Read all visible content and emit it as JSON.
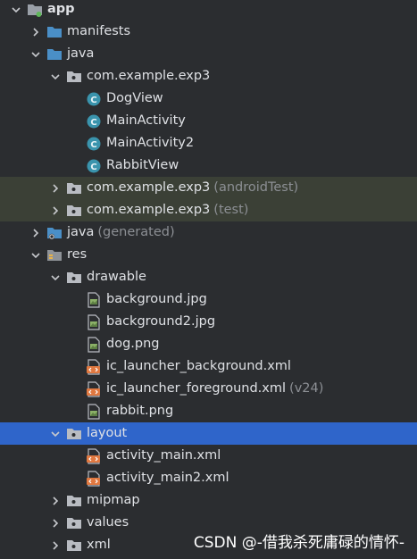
{
  "tree": {
    "rows": [
      {
        "label": "app",
        "suffix": "",
        "icon": "module-folder-icon",
        "depth": 0,
        "chevron": "down"
      },
      {
        "label": "manifests",
        "suffix": "",
        "icon": "folder-icon",
        "depth": 1,
        "chevron": "right"
      },
      {
        "label": "java",
        "suffix": "",
        "icon": "folder-icon",
        "depth": 1,
        "chevron": "down"
      },
      {
        "label": "com.example.exp3",
        "suffix": "",
        "icon": "package-icon",
        "depth": 2,
        "chevron": "down"
      },
      {
        "label": "DogView",
        "suffix": "",
        "icon": "class-icon",
        "depth": 3,
        "chevron": "none"
      },
      {
        "label": "MainActivity",
        "suffix": "",
        "icon": "class-icon",
        "depth": 3,
        "chevron": "none"
      },
      {
        "label": "MainActivity2",
        "suffix": "",
        "icon": "class-icon",
        "depth": 3,
        "chevron": "none"
      },
      {
        "label": "RabbitView",
        "suffix": "",
        "icon": "class-icon",
        "depth": 3,
        "chevron": "none"
      },
      {
        "label": "com.example.exp3",
        "suffix": "(androidTest)",
        "icon": "package-icon",
        "depth": 2,
        "chevron": "right"
      },
      {
        "label": "com.example.exp3",
        "suffix": "(test)",
        "icon": "package-icon",
        "depth": 2,
        "chevron": "right"
      },
      {
        "label": "java",
        "suffix": "(generated)",
        "icon": "generated-folder-icon",
        "depth": 1,
        "chevron": "right"
      },
      {
        "label": "res",
        "suffix": "",
        "icon": "res-folder-icon",
        "depth": 1,
        "chevron": "down"
      },
      {
        "label": "drawable",
        "suffix": "",
        "icon": "package-icon",
        "depth": 2,
        "chevron": "down"
      },
      {
        "label": "background.jpg",
        "suffix": "",
        "icon": "image-file-icon",
        "depth": 3,
        "chevron": "none"
      },
      {
        "label": "background2.jpg",
        "suffix": "",
        "icon": "image-file-icon",
        "depth": 3,
        "chevron": "none"
      },
      {
        "label": "dog.png",
        "suffix": "",
        "icon": "image-file-icon",
        "depth": 3,
        "chevron": "none"
      },
      {
        "label": "ic_launcher_background.xml",
        "suffix": "",
        "icon": "xml-file-icon",
        "depth": 3,
        "chevron": "none"
      },
      {
        "label": "ic_launcher_foreground.xml",
        "suffix": "(v24)",
        "icon": "xml-file-icon",
        "depth": 3,
        "chevron": "none"
      },
      {
        "label": "rabbit.png",
        "suffix": "",
        "icon": "image-file-icon",
        "depth": 3,
        "chevron": "none"
      },
      {
        "label": "layout",
        "suffix": "",
        "icon": "package-icon",
        "depth": 2,
        "chevron": "down"
      },
      {
        "label": "activity_main.xml",
        "suffix": "",
        "icon": "xml-file-icon",
        "depth": 3,
        "chevron": "none"
      },
      {
        "label": "activity_main2.xml",
        "suffix": "",
        "icon": "xml-file-icon",
        "depth": 3,
        "chevron": "none"
      },
      {
        "label": "mipmap",
        "suffix": "",
        "icon": "package-icon",
        "depth": 2,
        "chevron": "right"
      },
      {
        "label": "values",
        "suffix": "",
        "icon": "package-icon",
        "depth": 2,
        "chevron": "right"
      },
      {
        "label": "xml",
        "suffix": "",
        "icon": "package-icon",
        "depth": 2,
        "chevron": "right"
      }
    ],
    "selected_row": "layout",
    "test_rows": [
      "(androidTest)",
      "(test)"
    ]
  },
  "watermark": {
    "text": "CSDN @-借我杀死庸碌的情怀-"
  },
  "colors": {
    "background": "#2b2d30",
    "selection": "#2f65ca",
    "test_highlight": "#3b4036",
    "folder_blue": "#4a8fc7",
    "package_grey": "#b9bcc2",
    "class_teal": "#3a94ad",
    "xml_orange": "#e07840",
    "image_green": "#8bb067"
  }
}
